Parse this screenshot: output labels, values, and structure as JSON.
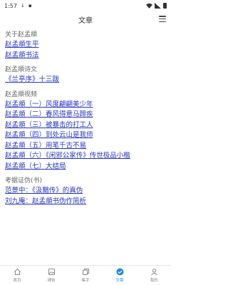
{
  "status_bar": {
    "time": "1:57",
    "download_icon": "↓",
    "notice_icon": "▪"
  },
  "header": {
    "title": "文章"
  },
  "sections": [
    {
      "heading": "关于赵孟頫",
      "links": [
        "赵孟頫生平",
        "赵孟頫书法"
      ]
    },
    {
      "heading": "赵孟頫诗文",
      "links": [
        "《兰亭序》十三跋"
      ]
    },
    {
      "heading": "赵孟頫视频",
      "links": [
        "赵孟頫（一）风度翩翩美少年",
        "赵孟頫（二）春风得意马蹄疾",
        "赵孟頫（三）被暴击的打工人",
        "赵孟頫（四）到处云山是我师",
        "赵孟頫（五）用笔千古不易",
        "赵孟頫（六）《闲邪公家传》传世极品小楷",
        "赵孟頫（七）大结局"
      ]
    },
    {
      "heading": "考据证伪(书)",
      "links": [
        "范景中：《汲黯传》的真伪",
        "刘九庵：赵孟頫书伪作简析"
      ]
    }
  ],
  "tab_bar": {
    "active_tab": "文章",
    "active_color": "#1e88e5",
    "inactive_color": "#888888",
    "tabs": [
      {
        "label": "首页",
        "icon": "home-icon"
      },
      {
        "label": "碑帖",
        "icon": "image-icon"
      },
      {
        "label": "集字",
        "icon": "collect-icon"
      },
      {
        "label": "文章",
        "icon": "check-circle-icon"
      },
      {
        "label": "我的",
        "icon": "user-icon"
      }
    ]
  }
}
